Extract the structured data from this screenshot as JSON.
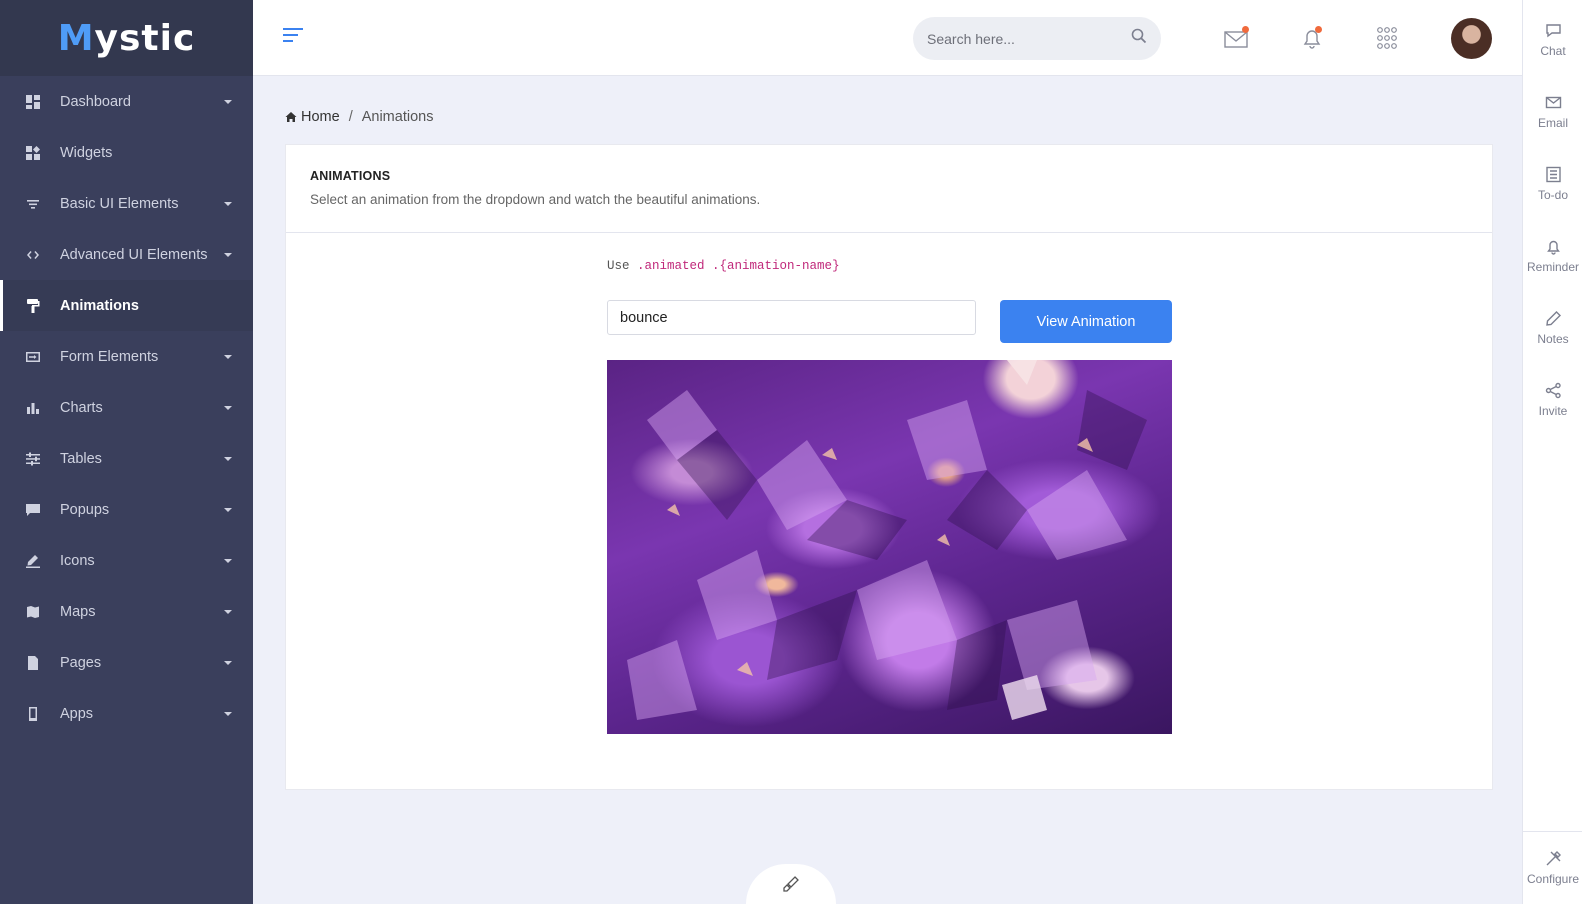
{
  "brand": {
    "name_first": "M",
    "name_rest": "ystic"
  },
  "sidebar": {
    "items": [
      {
        "label": "Dashboard",
        "icon": "dashboard-icon",
        "has_children": true
      },
      {
        "label": "Widgets",
        "icon": "widgets-icon",
        "has_children": false
      },
      {
        "label": "Basic UI Elements",
        "icon": "filter-icon",
        "has_children": true
      },
      {
        "label": "Advanced UI Elements",
        "icon": "code-icon",
        "has_children": true
      },
      {
        "label": "Animations",
        "icon": "paint-roller-icon",
        "has_children": false,
        "active": true
      },
      {
        "label": "Form Elements",
        "icon": "form-icon",
        "has_children": true
      },
      {
        "label": "Charts",
        "icon": "bar-chart-icon",
        "has_children": true
      },
      {
        "label": "Tables",
        "icon": "sliders-icon",
        "has_children": true
      },
      {
        "label": "Popups",
        "icon": "comment-icon",
        "has_children": true
      },
      {
        "label": "Icons",
        "icon": "pen-icon",
        "has_children": true
      },
      {
        "label": "Maps",
        "icon": "map-icon",
        "has_children": true
      },
      {
        "label": "Pages",
        "icon": "file-icon",
        "has_children": true
      },
      {
        "label": "Apps",
        "icon": "phone-icon",
        "has_children": true
      }
    ]
  },
  "header": {
    "search_placeholder": "Search here..."
  },
  "rightbar": {
    "items": [
      {
        "label": "Chat",
        "icon": "chat-icon"
      },
      {
        "label": "Email",
        "icon": "email-icon"
      },
      {
        "label": "To-do",
        "icon": "todo-icon"
      },
      {
        "label": "Reminder",
        "icon": "bell-icon"
      },
      {
        "label": "Notes",
        "icon": "pencil-icon"
      },
      {
        "label": "Invite",
        "icon": "share-icon"
      }
    ],
    "configure_label": "Configure"
  },
  "breadcrumb": {
    "home": "Home",
    "separator": "/",
    "current": "Animations"
  },
  "card": {
    "title": "ANIMATIONS",
    "subtitle": "Select an animation from the dropdown and watch the beautiful animations.",
    "usage_prefix": "Use",
    "usage_code": ".animated .{animation-name}",
    "selected_animation": "bounce",
    "button_label": "View Animation"
  },
  "colors": {
    "sidebar": "#3a3f5c",
    "accent": "#3b82f0",
    "code": "#c0287a",
    "badge": "#f06a3c"
  }
}
